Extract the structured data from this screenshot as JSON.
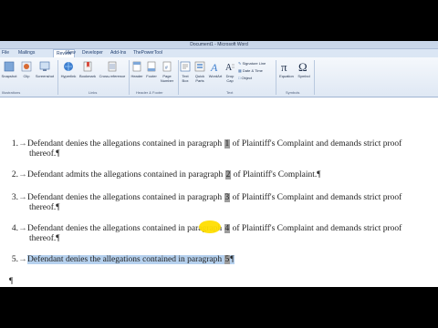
{
  "window": {
    "title": "Document1 - Microsoft Word"
  },
  "tabs": [
    {
      "label": "File"
    },
    {
      "label": "Mailings"
    },
    {
      "label": "Review"
    },
    {
      "label": "View"
    },
    {
      "label": "Developer"
    },
    {
      "label": "Add-Ins"
    },
    {
      "label": "ThePowerTool"
    }
  ],
  "ribbon": {
    "pages": {
      "snapshot": "Snapshot",
      "clip_art": "Clip",
      "screenshot": "Screenshot",
      "group": "Illustrations"
    },
    "links": {
      "hyperlink": "Hyperlink",
      "bookmark": "Bookmark",
      "cross_reference": "Cross-reference",
      "group": "Links"
    },
    "header_footer": {
      "header": "Header",
      "footer": "Footer",
      "page_number": "Page Number",
      "group": "Header & Footer"
    },
    "text": {
      "text_box": "Text Box",
      "quick_parts": "Quick Parts",
      "wordart": "WordArt",
      "drop_cap": "Drop Cap",
      "signature_line": "Signature Line",
      "date_time": "Date & Time",
      "object": "Object",
      "group": "Text"
    },
    "symbols": {
      "equation": "Equation",
      "symbol": "Symbol",
      "group": "Symbols"
    }
  },
  "document": {
    "paragraphs": [
      {
        "num": "1.",
        "before": "Defendant denies the allegations contained in paragraph ",
        "ref": "1",
        "after": " of Plaintiff's Complaint and demands strict proof",
        "cont": "thereof.¶"
      },
      {
        "num": "2.",
        "before": "Defendant admits the allegations contained in paragraph ",
        "ref": "2",
        "after": " of Plaintiff's Complaint.¶",
        "cont": ""
      },
      {
        "num": "3.",
        "before": "Defendant denies the allegations contained in paragraph ",
        "ref": "3",
        "after": " of Plaintiff's Complaint and demands strict proof",
        "cont": "thereof.¶"
      },
      {
        "num": "4.",
        "before": "Defendant denies the allegations contained in paragraph ",
        "ref": "4",
        "after": " of Plaintiff's Complaint and demands strict proof",
        "cont": "thereof.¶"
      },
      {
        "num": "5.",
        "before": "Defendant denies the allegations contained in paragraph ",
        "ref": "5",
        "after": "¶",
        "cont": ""
      }
    ],
    "empty_mark": "¶"
  },
  "icons": [
    "snapshot-icon",
    "clip-art-icon",
    "screenshot-icon",
    "hyperlink-icon",
    "bookmark-icon",
    "cross-reference-icon",
    "header-icon",
    "footer-icon",
    "page-number-icon",
    "text-box-icon",
    "quick-parts-icon",
    "wordart-icon",
    "drop-cap-icon",
    "equation-icon",
    "symbol-icon"
  ],
  "colors": {
    "ribbon_bg": "#dfe8f4",
    "selection": "#b6d1ee",
    "field_shading": "#9d9d9d",
    "highlight_cursor": "#ffde00"
  }
}
